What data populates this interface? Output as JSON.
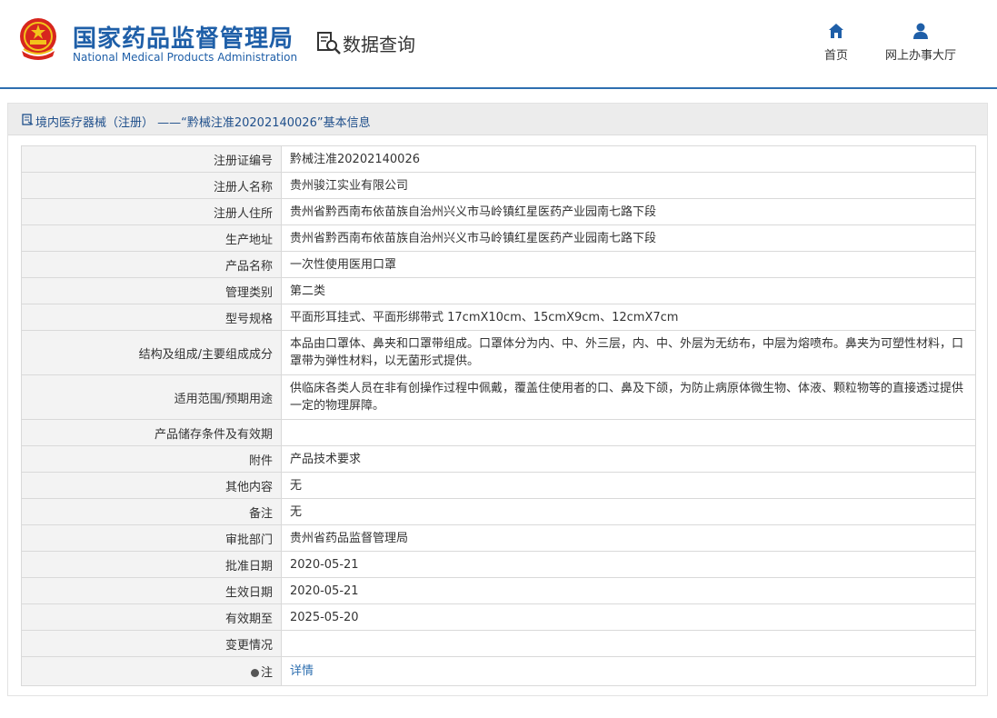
{
  "header": {
    "site_name_cn": "国家药品监督管理局",
    "site_name_en": "National Medical Products Administration",
    "section": "数据查询",
    "nav": [
      {
        "label": "首页",
        "icon": "home-icon"
      },
      {
        "label": "网上办事大厅",
        "icon": "user-icon"
      }
    ]
  },
  "breadcrumb": "境内医疗器械（注册） ——“黔械注准20202140026”基本信息",
  "colors": {
    "brand": "#1f5fa8",
    "link": "#2e6fb0",
    "label_bg": "#f3f3f3"
  },
  "rows": [
    {
      "label": "注册证编号",
      "value": "黔械注准20202140026"
    },
    {
      "label": "注册人名称",
      "value": "贵州骏江实业有限公司"
    },
    {
      "label": "注册人住所",
      "value": "贵州省黔西南布依苗族自治州兴义市马岭镇红星医药产业园南七路下段"
    },
    {
      "label": "生产地址",
      "value": "贵州省黔西南布依苗族自治州兴义市马岭镇红星医药产业园南七路下段"
    },
    {
      "label": "产品名称",
      "value": "一次性使用医用口罩"
    },
    {
      "label": "管理类别",
      "value": "第二类"
    },
    {
      "label": "型号规格",
      "value": "平面形耳挂式、平面形绑带式 17cmX10cm、15cmX9cm、12cmX7cm"
    },
    {
      "label": "结构及组成/主要组成成分",
      "value": "本品由口罩体、鼻夹和口罩带组成。口罩体分为内、中、外三层，内、中、外层为无纺布，中层为熔喷布。鼻夹为可塑性材料，口罩带为弹性材料，以无菌形式提供。"
    },
    {
      "label": "适用范围/预期用途",
      "value": "供临床各类人员在非有创操作过程中佩戴，覆盖住使用者的口、鼻及下颌，为防止病原体微生物、体液、颗粒物等的直接透过提供一定的物理屏障。"
    },
    {
      "label": "产品储存条件及有效期",
      "value": ""
    },
    {
      "label": "附件",
      "value": "产品技术要求"
    },
    {
      "label": "其他内容",
      "value": "无"
    },
    {
      "label": "备注",
      "value": "无"
    },
    {
      "label": "审批部门",
      "value": "贵州省药品监督管理局"
    },
    {
      "label": "批准日期",
      "value": "2020-05-21"
    },
    {
      "label": "生效日期",
      "value": "2020-05-21"
    },
    {
      "label": "有效期至",
      "value": "2025-05-20"
    },
    {
      "label": "变更情况",
      "value": ""
    }
  ],
  "note_row": {
    "label": "注",
    "link": "详情"
  }
}
